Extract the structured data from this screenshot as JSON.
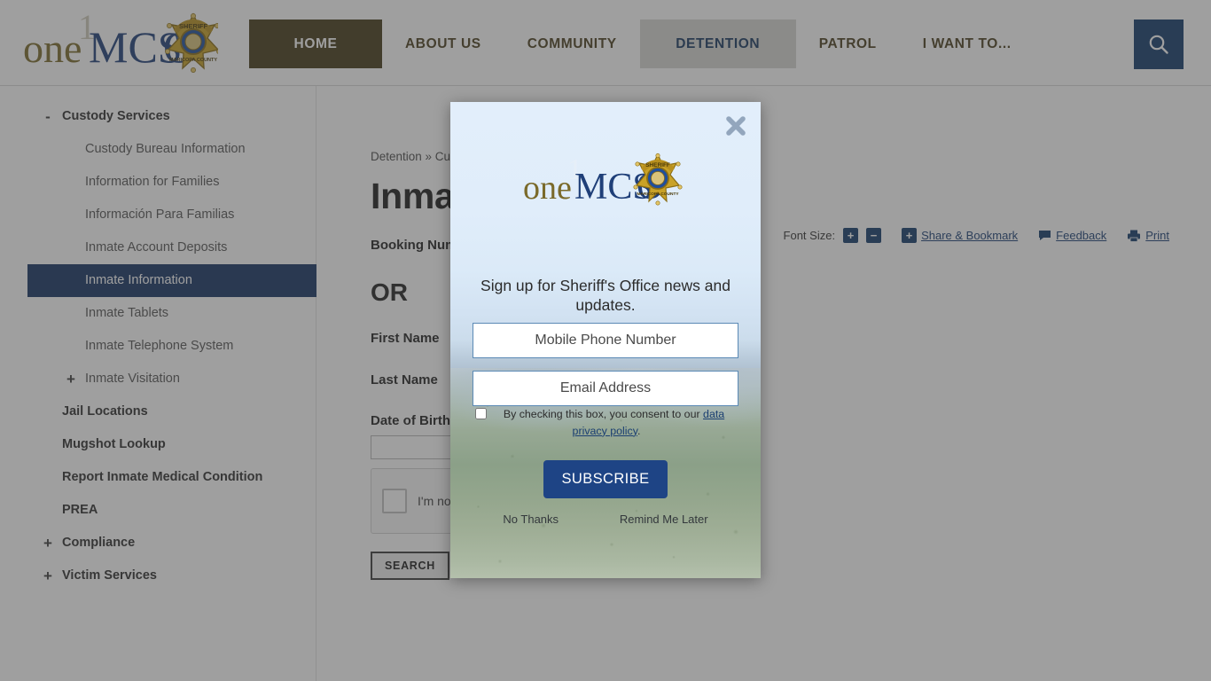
{
  "site": {
    "logo_text_one": "one",
    "logo_text_mcs": "MCS",
    "logo_text_o": "O",
    "logo_superscript": "1",
    "badge_top_text": "SHERIFF",
    "badge_bottom_text": "MARICOPA COUNTY"
  },
  "nav": {
    "items": [
      {
        "label": "HOME",
        "state": "active-home"
      },
      {
        "label": "ABOUT US",
        "state": "normal"
      },
      {
        "label": "COMMUNITY",
        "state": "normal"
      },
      {
        "label": "DETENTION",
        "state": "active-section"
      },
      {
        "label": "PATROL",
        "state": "normal"
      },
      {
        "label": "I WANT TO...",
        "state": "normal"
      }
    ],
    "search_icon": "search-icon"
  },
  "sidebar": {
    "items": [
      {
        "label": "Custody Services",
        "level": 1,
        "toggle": "-",
        "selected": false
      },
      {
        "label": "Custody Bureau Information",
        "level": 2,
        "toggle": "",
        "selected": false
      },
      {
        "label": "Information for Families",
        "level": 2,
        "toggle": "",
        "selected": false
      },
      {
        "label": "Información Para Familias",
        "level": 2,
        "toggle": "",
        "selected": false
      },
      {
        "label": "Inmate Account Deposits",
        "level": 2,
        "toggle": "",
        "selected": false
      },
      {
        "label": "Inmate Information",
        "level": 2,
        "toggle": "",
        "selected": true
      },
      {
        "label": "Inmate Tablets",
        "level": 2,
        "toggle": "",
        "selected": false
      },
      {
        "label": "Inmate Telephone System",
        "level": 2,
        "toggle": "",
        "selected": false
      },
      {
        "label": "Inmate Visitation",
        "level": 2,
        "toggle": "+",
        "selected": false
      },
      {
        "label": "Jail Locations",
        "level": 1,
        "toggle": "",
        "selected": false
      },
      {
        "label": "Mugshot Lookup",
        "level": 1,
        "toggle": "",
        "selected": false
      },
      {
        "label": "Report Inmate Medical Condition",
        "level": 1,
        "toggle": "",
        "selected": false
      },
      {
        "label": "PREA",
        "level": 1,
        "toggle": "",
        "selected": false
      },
      {
        "label": "Compliance",
        "level": 1,
        "toggle": "+",
        "selected": false
      },
      {
        "label": "Victim Services",
        "level": 1,
        "toggle": "+",
        "selected": false
      }
    ]
  },
  "main": {
    "breadcrumb": "Detention » Custody Services",
    "title": "Inmate Information",
    "tools": {
      "font_size_label": "Font Size:",
      "increase": "+",
      "decrease": "−",
      "share_plus": "+",
      "share_label": "Share & Bookmark",
      "feedback_label": "Feedback",
      "print_label": "Print"
    },
    "form": {
      "booking_label": "Booking Number",
      "booking_value": "",
      "or_text": "OR",
      "first_name_label": "First Name",
      "first_name_value": "",
      "last_name_label": "Last Name",
      "last_name_value": "",
      "dob_label": "Date of Birth",
      "dob_value": "",
      "recaptcha_label": "I'm not a robot",
      "submit_label": "SEARCH"
    }
  },
  "modal": {
    "close_icon": "close-icon",
    "heading": "Sign up for Sheriff's Office news and updates.",
    "phone_placeholder": "Mobile Phone Number",
    "phone_value": "",
    "email_placeholder": "Email Address",
    "email_value": "",
    "consent_prefix": "By checking this box, you consent to our ",
    "consent_link": "data privacy policy",
    "consent_suffix": ".",
    "subscribe_label": "SUBSCRIBE",
    "no_thanks_label": "No Thanks",
    "remind_label": "Remind Me Later"
  },
  "colors": {
    "brand_navy": "#123a6b",
    "nav_active_brown": "#453a18",
    "sidebar_selected": "#153262",
    "subscribe_blue": "#1e4485",
    "badge_gold": "#c9a227"
  }
}
